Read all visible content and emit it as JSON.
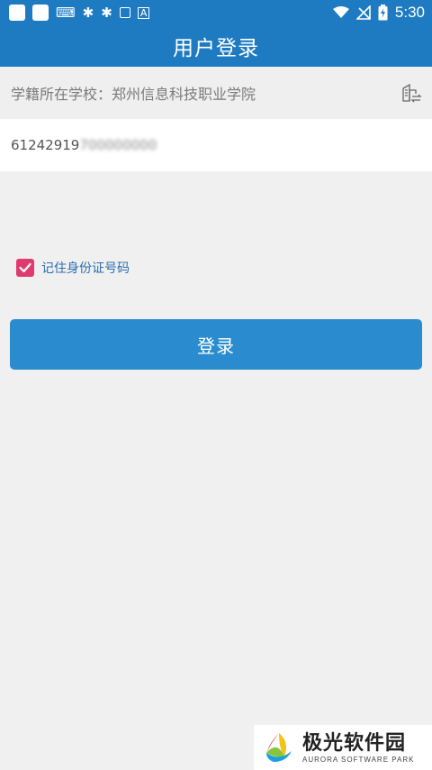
{
  "status_bar": {
    "time": "5:30",
    "left_icons": [
      "app-square-icon",
      "app-square-icon",
      "keyboard-icon",
      "bug-icon",
      "bug-icon",
      "message-icon",
      "font-a-icon"
    ],
    "right_icons": [
      "wifi-icon",
      "no-signal-icon",
      "battery-charging-icon"
    ]
  },
  "header": {
    "title": "用户登录"
  },
  "form": {
    "school_label": "学籍所在学校：郑州信息科技职业学院",
    "school_icon": "school-select-icon",
    "id_visible": "61242919",
    "id_obscured": "700000000"
  },
  "remember": {
    "label": "记住身份证号码",
    "checked": true
  },
  "login": {
    "label": "登录"
  },
  "watermark": {
    "cn": "极光软件园",
    "en": "AURORA SOFTWARE PARK"
  },
  "colors": {
    "primary": "#1f7bc1",
    "button": "#2a8ccf",
    "checkbox": "#e03a71",
    "background": "#f0f0f0"
  }
}
